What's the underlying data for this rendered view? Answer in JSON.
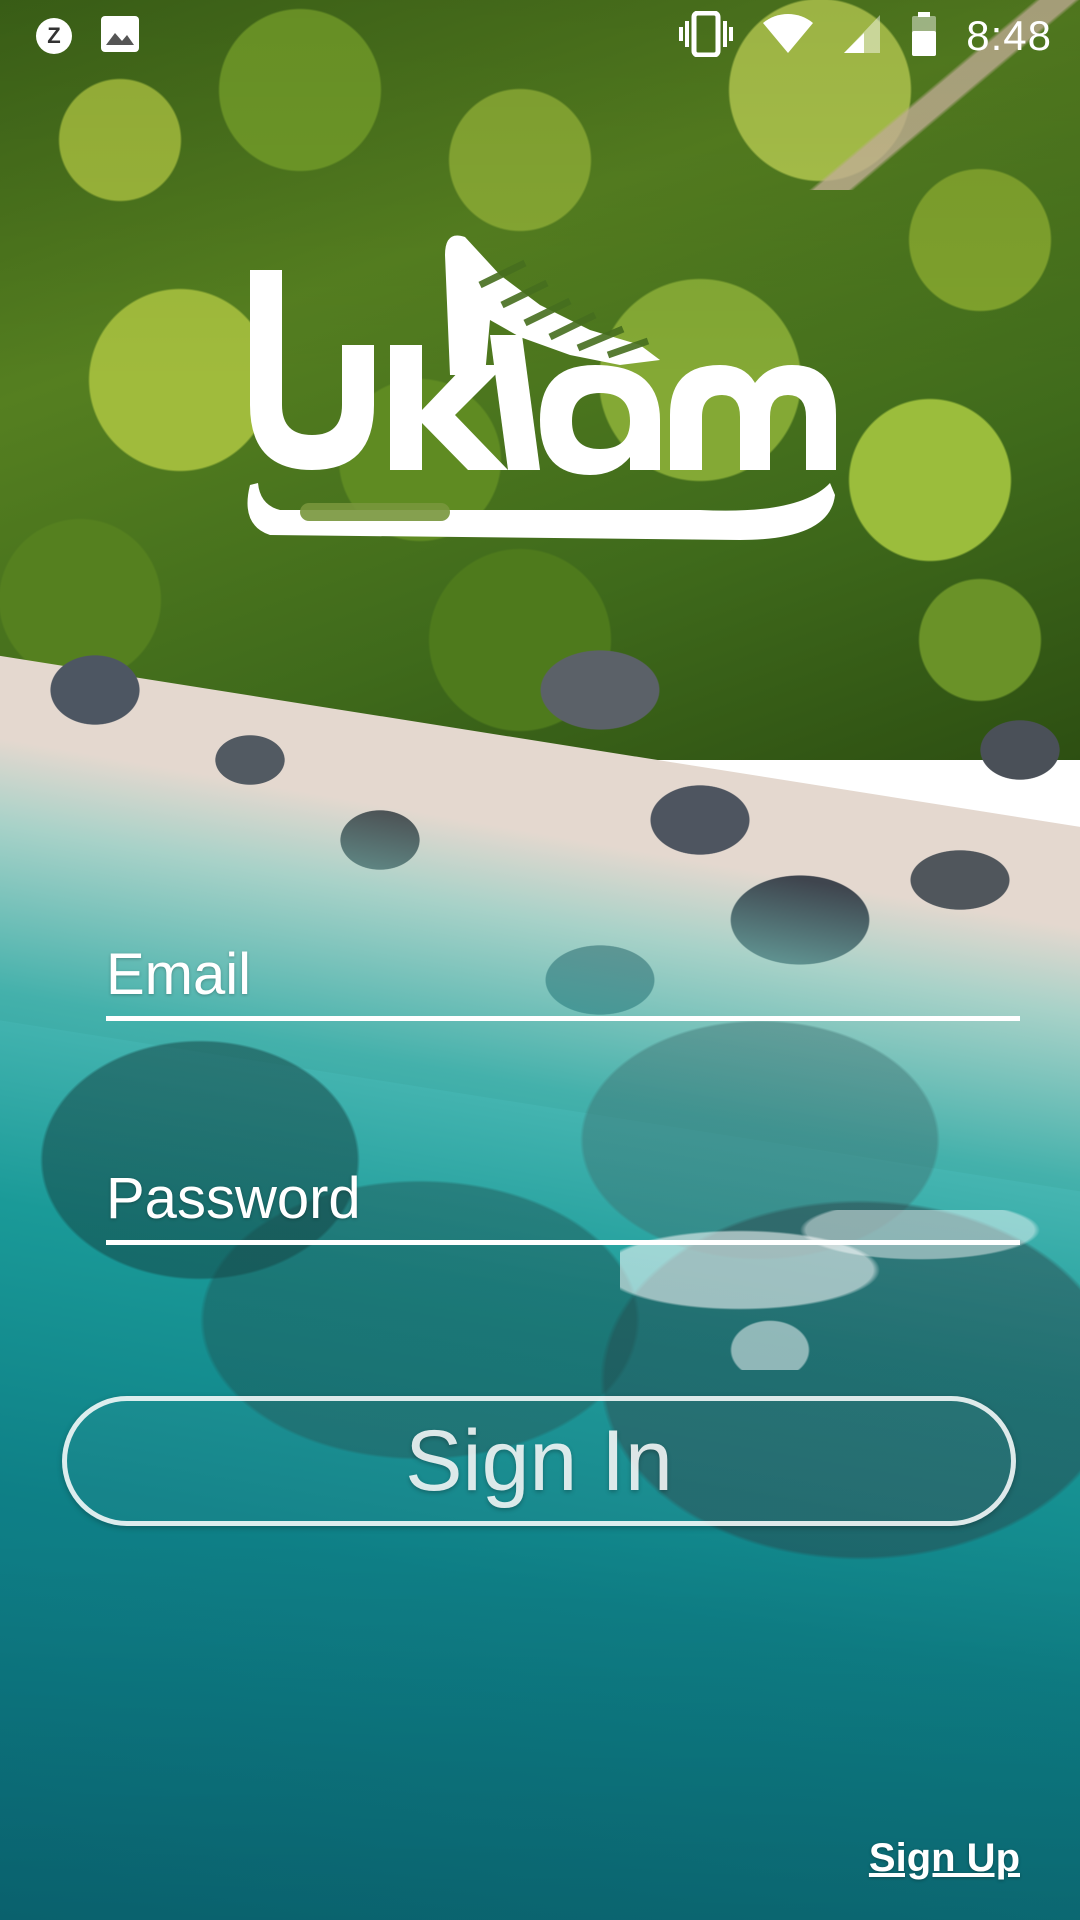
{
  "status_bar": {
    "time": "8:48",
    "notification_badge": "Z",
    "icons": [
      "z-notification-icon",
      "image-icon",
      "vibrate-icon",
      "wifi-icon",
      "cell-signal-icon",
      "battery-icon"
    ]
  },
  "logo": {
    "text": "uklam",
    "color": "#ffffff"
  },
  "form": {
    "email_placeholder": "Email",
    "password_placeholder": "Password",
    "sign_in_label": "Sign In"
  },
  "footer": {
    "sign_up_label": "Sign Up"
  }
}
